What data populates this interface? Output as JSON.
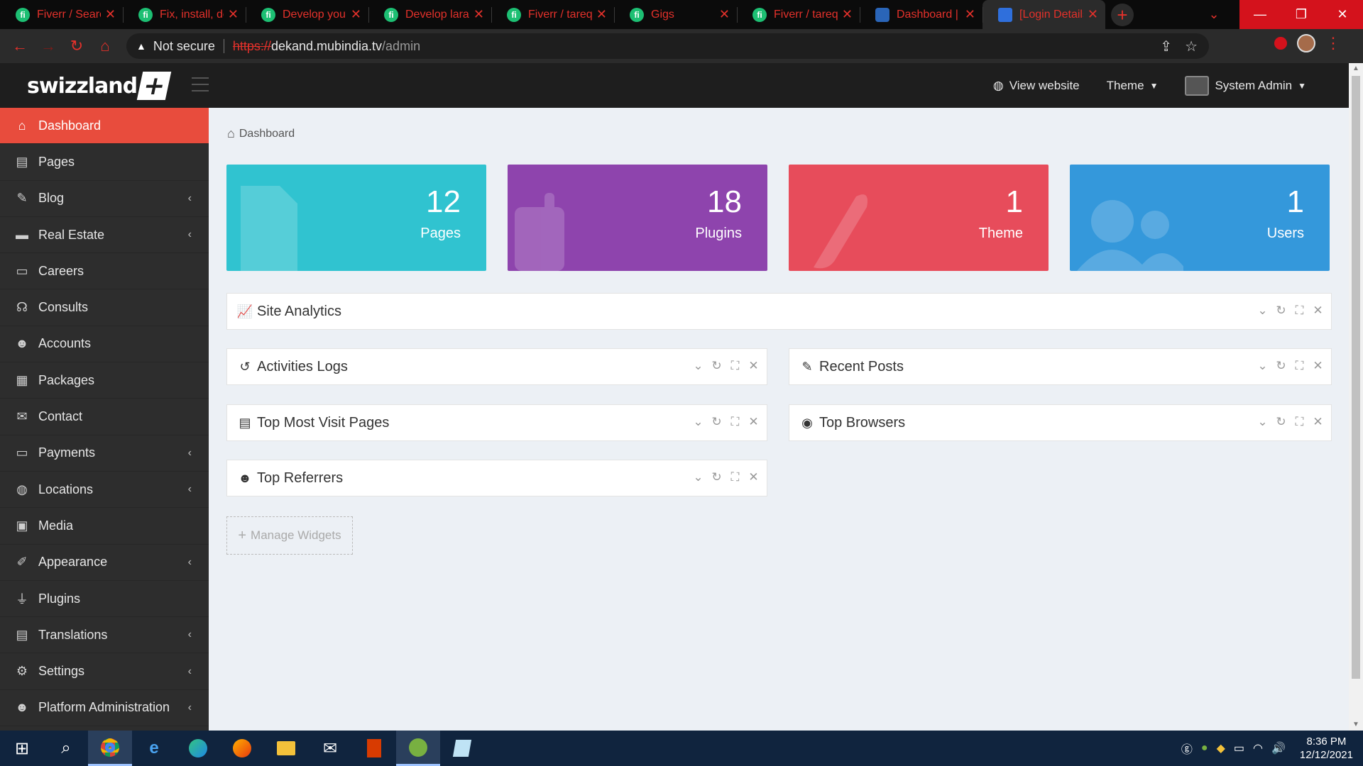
{
  "browser": {
    "tabs": [
      {
        "title": "Fiverr / Search",
        "favicon": "fiverr-icon",
        "fav_text": "fi"
      },
      {
        "title": "Fix, install, de",
        "favicon": "fiverr-icon",
        "fav_text": "fi"
      },
      {
        "title": "Develop your",
        "favicon": "fiverr-icon",
        "fav_text": "fi"
      },
      {
        "title": "Develop larav",
        "favicon": "fiverr-icon",
        "fav_text": "fi"
      },
      {
        "title": "Fiverr / tareq",
        "favicon": "fiverr-icon",
        "fav_text": "fi"
      },
      {
        "title": "Gigs",
        "favicon": "fiverr-icon",
        "fav_text": "fi"
      },
      {
        "title": "Fiverr / tareq",
        "favicon": "fiverr-icon",
        "fav_text": "fi"
      },
      {
        "title": "Dashboard | S",
        "favicon": "edge-icon",
        "fav_text": ""
      },
      {
        "title": "[Login Details",
        "favicon": "doc-icon",
        "fav_text": ""
      }
    ],
    "security_label": "Not secure",
    "url_scheme": "https://",
    "url_host": "dekand.mubindia.tv",
    "url_path": "/admin"
  },
  "header": {
    "brand": "swizzland",
    "brand_symbol": "+",
    "view_website": "View website",
    "theme": "Theme",
    "user": "System Admin"
  },
  "sidebar": {
    "items": [
      {
        "label": "Dashboard",
        "icon": "home-icon",
        "glyph": "⌂",
        "has_caret": false,
        "active": true
      },
      {
        "label": "Pages",
        "icon": "pages-icon",
        "glyph": "▤",
        "has_caret": false
      },
      {
        "label": "Blog",
        "icon": "edit-icon",
        "glyph": "✎",
        "has_caret": true
      },
      {
        "label": "Real Estate",
        "icon": "bed-icon",
        "glyph": "▬",
        "has_caret": true
      },
      {
        "label": "Careers",
        "icon": "id-card-icon",
        "glyph": "▭",
        "has_caret": false
      },
      {
        "label": "Consults",
        "icon": "headset-icon",
        "glyph": "☊",
        "has_caret": false
      },
      {
        "label": "Accounts",
        "icon": "users-icon",
        "glyph": "☻",
        "has_caret": false
      },
      {
        "label": "Packages",
        "icon": "package-icon",
        "glyph": "▦",
        "has_caret": false
      },
      {
        "label": "Contact",
        "icon": "envelope-icon",
        "glyph": "✉",
        "has_caret": false
      },
      {
        "label": "Payments",
        "icon": "credit-card-icon",
        "glyph": "▭",
        "has_caret": true
      },
      {
        "label": "Locations",
        "icon": "globe-icon",
        "glyph": "◍",
        "has_caret": true
      },
      {
        "label": "Media",
        "icon": "images-icon",
        "glyph": "▣",
        "has_caret": false
      },
      {
        "label": "Appearance",
        "icon": "brush-icon",
        "glyph": "✐",
        "has_caret": true
      },
      {
        "label": "Plugins",
        "icon": "plug-icon",
        "glyph": "⏚",
        "has_caret": false
      },
      {
        "label": "Translations",
        "icon": "language-icon",
        "glyph": "▤",
        "has_caret": true
      },
      {
        "label": "Settings",
        "icon": "cogs-icon",
        "glyph": "⚙",
        "has_caret": true
      },
      {
        "label": "Platform Administration",
        "icon": "user-shield-icon",
        "glyph": "☻",
        "has_caret": true
      }
    ]
  },
  "breadcrumb": {
    "label": "Dashboard"
  },
  "stats": [
    {
      "value": "12",
      "label": "Pages",
      "color": "#30c3d0"
    },
    {
      "value": "18",
      "label": "Plugins",
      "color": "#8e44ad"
    },
    {
      "value": "1",
      "label": "Theme",
      "color": "#e74c5b"
    },
    {
      "value": "1",
      "label": "Users",
      "color": "#3498db"
    }
  ],
  "widgets": {
    "site_analytics": "Site Analytics",
    "activities_logs": "Activities Logs",
    "recent_posts": "Recent Posts",
    "top_pages": "Top Most Visit Pages",
    "top_browsers": "Top Browsers",
    "top_referrers": "Top Referrers"
  },
  "manage_widgets": "Manage Widgets",
  "taskbar": {
    "time": "8:36 PM",
    "date": "12/12/2021"
  },
  "colors": {
    "accent": "#e84c3d",
    "browser_accent": "#e4312b",
    "sidebar_bg": "#2d2d2d",
    "header_bg": "#1e1e1e"
  }
}
